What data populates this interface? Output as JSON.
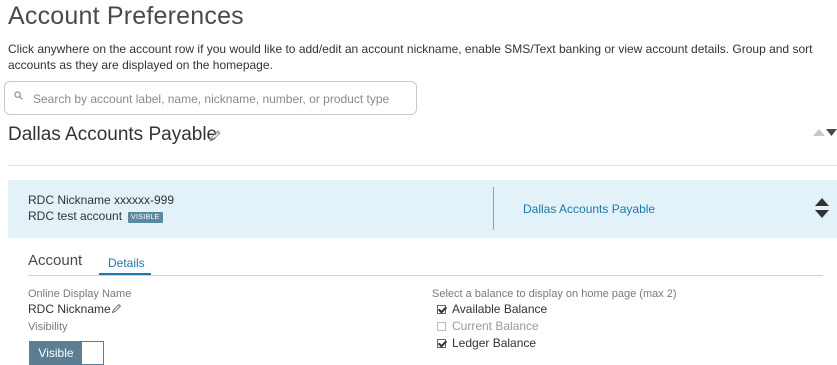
{
  "page": {
    "title": "Account Preferences",
    "description": "Click anywhere on the account row if you would like to add/edit an account nickname, enable SMS/Text banking or view account details. Group and sort accounts as they are displayed on the homepage."
  },
  "search": {
    "placeholder": "Search by account label, name, nickname, number, or product type",
    "value": ""
  },
  "group": {
    "name": "Dallas Accounts Payable"
  },
  "account_row": {
    "nickname_line": "RDC Nickname xxxxxx-999",
    "account_name": "RDC test account",
    "badge": "VISIBLE",
    "group_link": "Dallas Accounts Payable"
  },
  "tabs": {
    "section_title": "Account",
    "details": "Details"
  },
  "details": {
    "online_display_name_label": "Online Display Name",
    "online_display_name_value": "RDC Nickname",
    "visibility_label": "Visibility",
    "visibility_toggle": "Visible",
    "balance_label": "Select a balance to display on home page (max 2)",
    "balances": [
      {
        "label": "Available Balance",
        "checked": true
      },
      {
        "label": "Current Balance",
        "checked": false
      },
      {
        "label": "Ledger Balance",
        "checked": true
      }
    ]
  },
  "colors": {
    "accent_link": "#1a7aaa",
    "row_highlight": "#e3f2f8",
    "toggle": "#5b7e92"
  }
}
